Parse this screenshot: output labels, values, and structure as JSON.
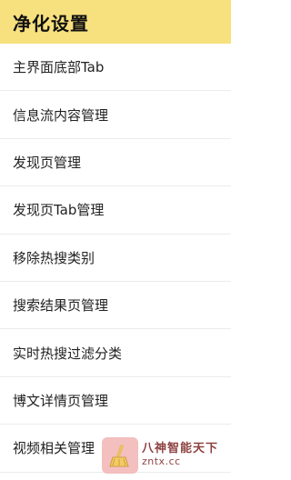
{
  "header": {
    "title": "净化设置"
  },
  "menu": {
    "items": [
      {
        "label": "主界面底部Tab"
      },
      {
        "label": "信息流内容管理"
      },
      {
        "label": "发现页管理"
      },
      {
        "label": "发现页Tab管理"
      },
      {
        "label": "移除热搜类别"
      },
      {
        "label": "搜索结果页管理"
      },
      {
        "label": "实时热搜过滤分类"
      },
      {
        "label": "博文详情页管理"
      },
      {
        "label": "视频相关管理"
      }
    ]
  },
  "watermark": {
    "line1": "八神智能天下",
    "line2": "zntx.cc"
  }
}
